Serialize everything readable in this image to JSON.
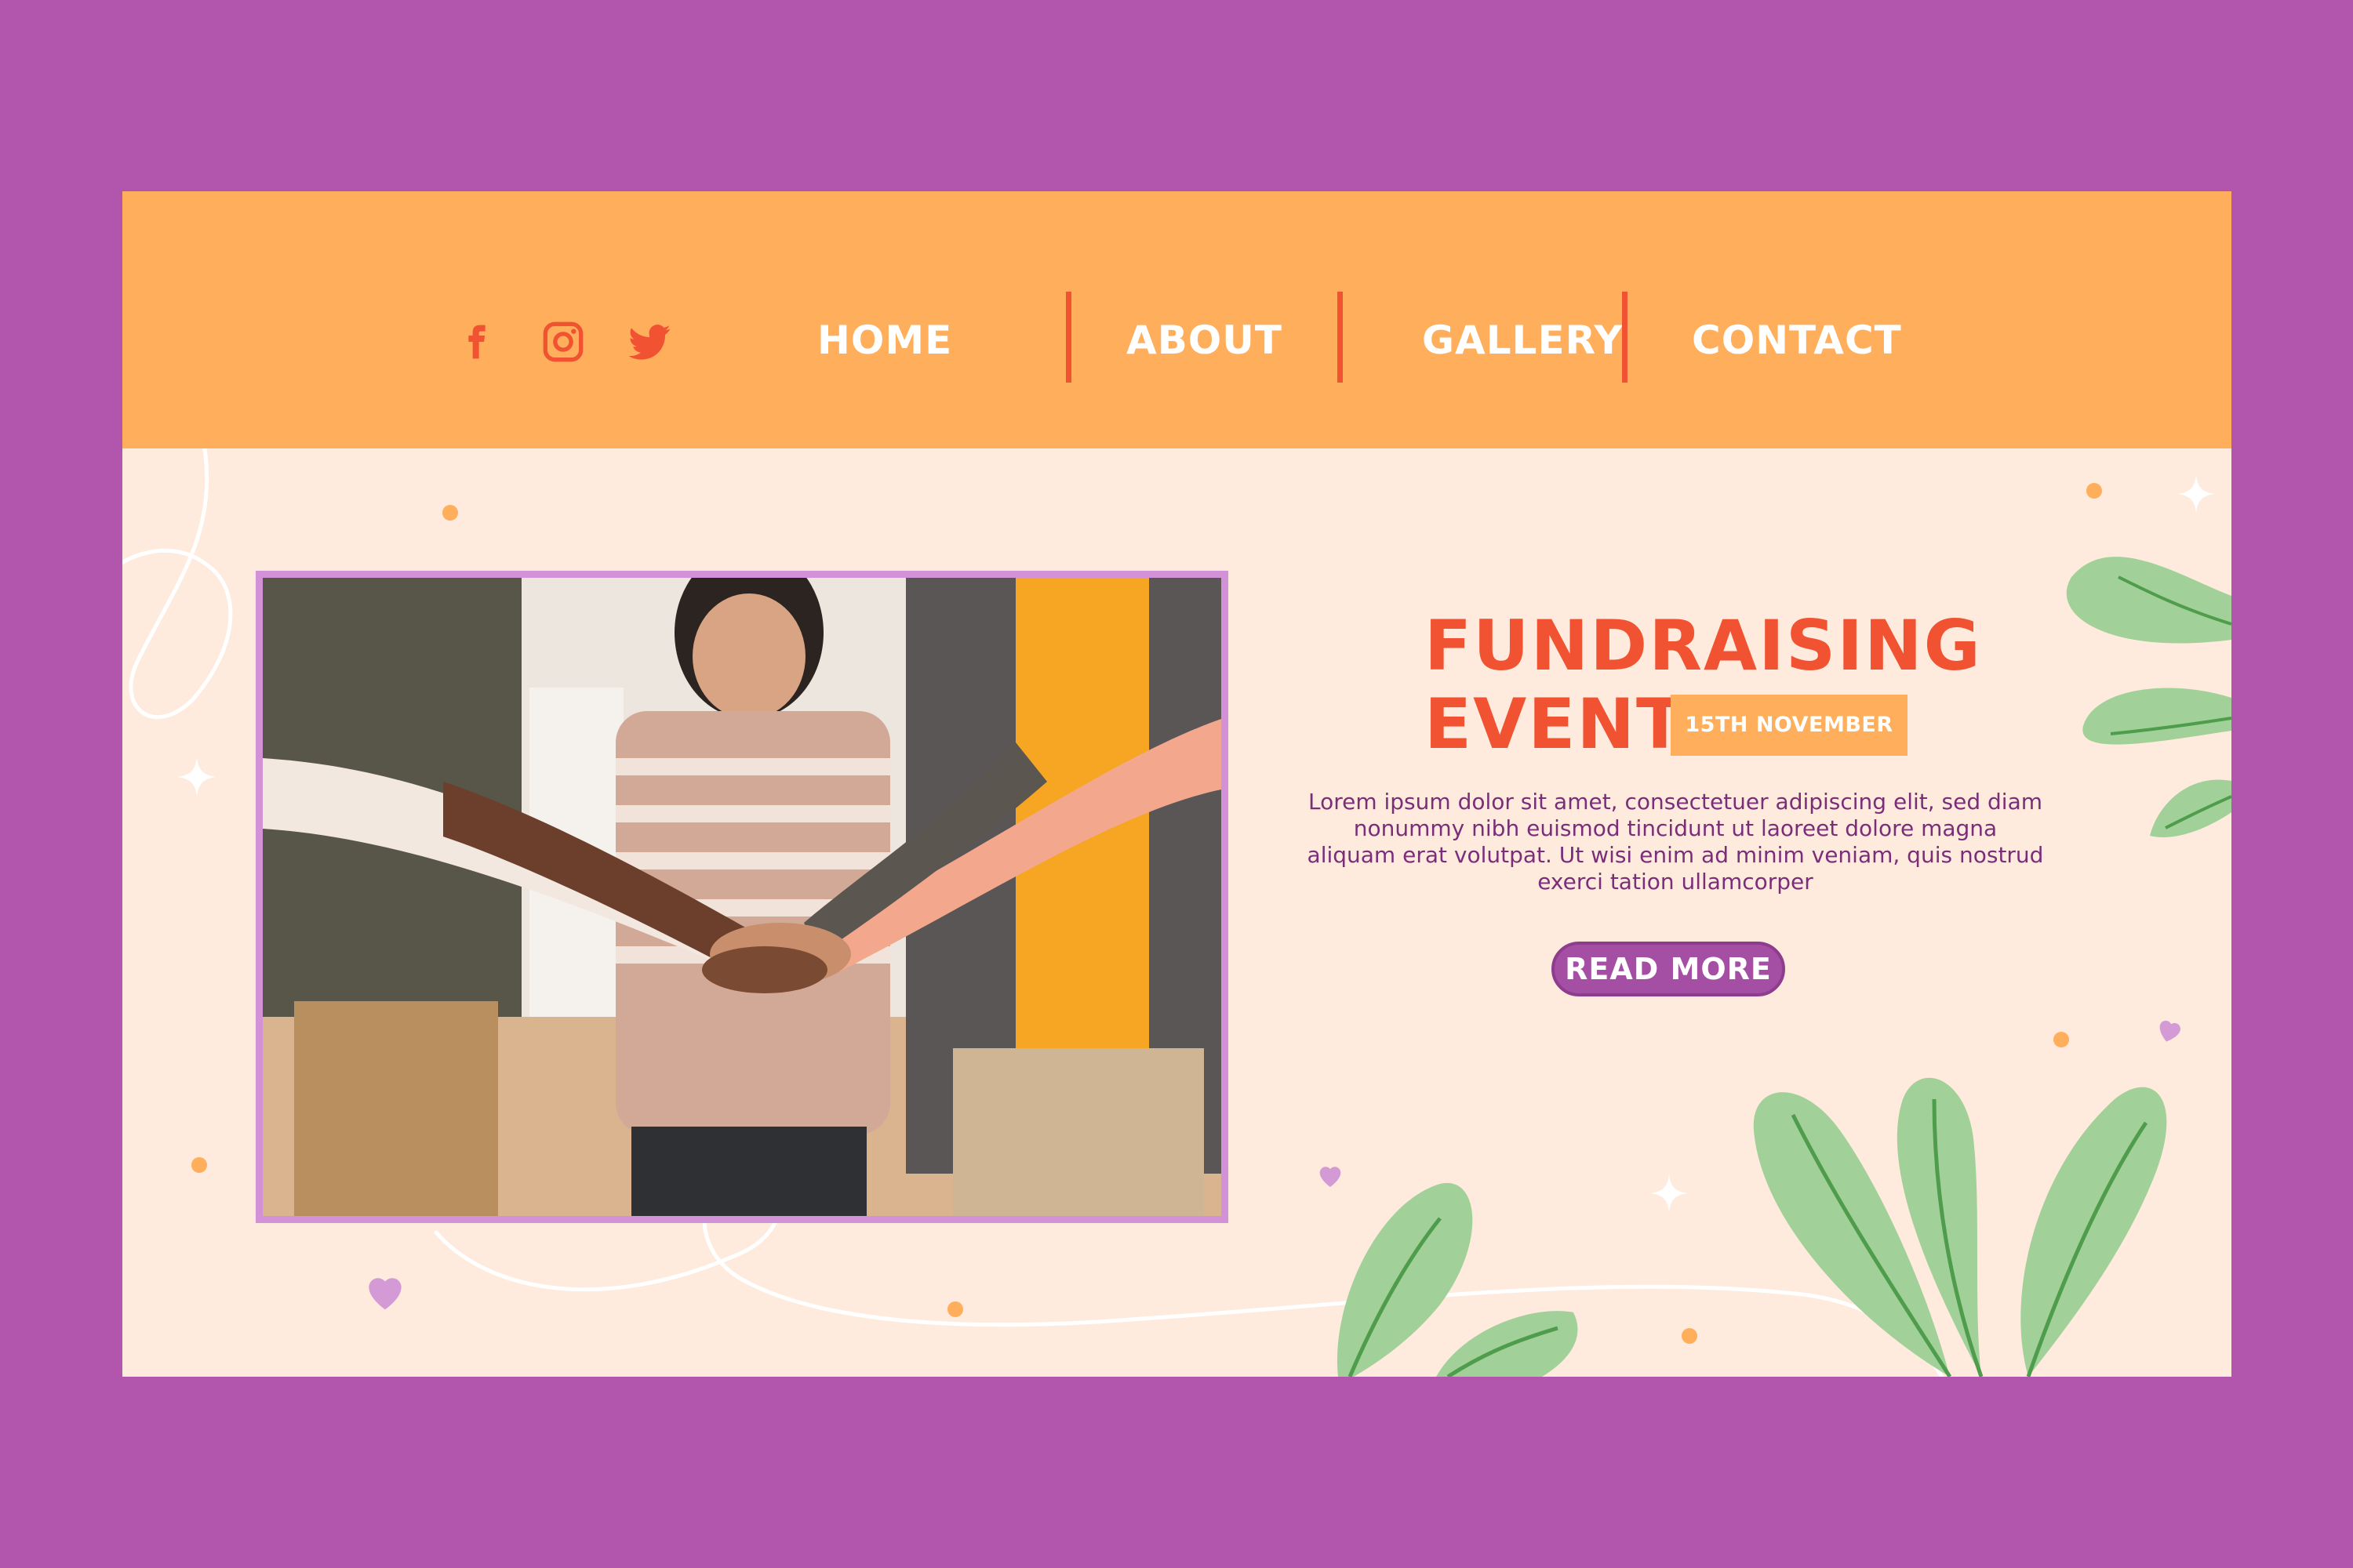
{
  "colors": {
    "background": "#b156ac",
    "page": "#ffebdd",
    "header": "#ffae5b",
    "accent": "#f05232",
    "button": "#a44ea4",
    "text": "#7a2e79",
    "leaf": "#a1d199",
    "heart": "#d39ad6",
    "dot": "#ffae5b"
  },
  "social": [
    {
      "icon": "facebook-icon"
    },
    {
      "icon": "instagram-icon"
    },
    {
      "icon": "twitter-icon"
    }
  ],
  "nav": {
    "home": "HOME",
    "about": "ABOUT",
    "gallery": "GALLERY",
    "contact": "CONTACT"
  },
  "hero": {
    "title_line1": "FUNDRAISING",
    "title_line2": "EVENT",
    "date": "15TH NOVEMBER",
    "body_line1": "Lorem ipsum dolor sit amet, consectetuer adipiscing elit, sed diam",
    "body_line2": "nonummy nibh euismod tincidunt ut laoreet dolore magna",
    "body_line3": "aliquam erat volutpat. Ut wisi enim ad minim veniam, quis nostrud",
    "body_line4": "exerci tation ullamcorper",
    "cta": "READ MORE"
  },
  "photo": {
    "icon": "team-hands-photo"
  }
}
